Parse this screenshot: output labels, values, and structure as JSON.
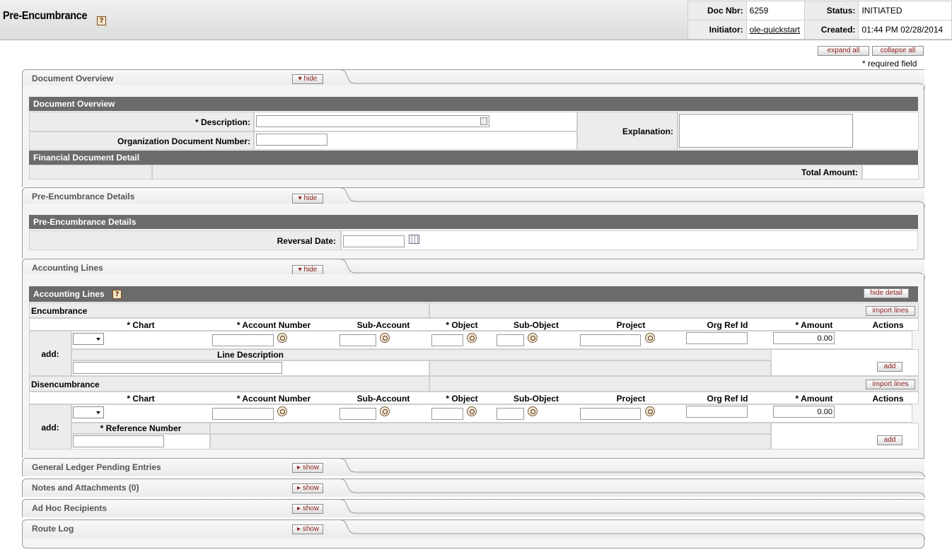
{
  "header": {
    "title": "Pre-Encumbrance",
    "help_icon": "question-icon",
    "doc_nbr_label": "Doc Nbr:",
    "doc_nbr": "6259",
    "status_label": "Status:",
    "status": "INITIATED",
    "initiator_label": "Initiator:",
    "initiator": "ole-quickstart",
    "created_label": "Created:",
    "created": "01:44 PM 02/28/2014"
  },
  "top_controls": {
    "expand_all": "expand all",
    "collapse_all": "collapse all",
    "required_note": "* required field"
  },
  "tabs": {
    "overview": {
      "title": "Document Overview",
      "toggle": "hide"
    },
    "details": {
      "title": "Pre-Encumbrance Details",
      "toggle": "hide"
    },
    "accounting": {
      "title": "Accounting Lines",
      "toggle": "hide"
    },
    "glpe": {
      "title": "General Ledger Pending Entries",
      "toggle": "show"
    },
    "notes": {
      "title": "Notes and Attachments (0)",
      "toggle": "show"
    },
    "adhoc": {
      "title": "Ad Hoc Recipients",
      "toggle": "show"
    },
    "route": {
      "title": "Route Log",
      "toggle": "show"
    }
  },
  "overview": {
    "section_title": "Document Overview",
    "description_label": "*  Description:",
    "org_doc_label": "Organization Document Number:",
    "explanation_label": "Explanation:",
    "fin_detail_title": "Financial Document Detail",
    "total_amount_label": "Total Amount:"
  },
  "details": {
    "section_title": "Pre-Encumbrance Details",
    "reversal_date_label": "Reversal Date:"
  },
  "accounting": {
    "section_title": "Accounting Lines",
    "hide_detail": "hide detail",
    "encumbrance_title": "Encumbrance",
    "disencumbrance_title": "Disencumbrance",
    "import_lines": "import lines",
    "columns": [
      "* Chart",
      "* Account Number",
      "Sub-Account",
      "* Object",
      "Sub-Object",
      "Project",
      "Org Ref Id",
      "* Amount",
      "Actions"
    ],
    "add_label": "add:",
    "line_description_label": "Line Description",
    "reference_number_label": "* Reference Number",
    "amount_value": "0.00",
    "add_button": "add"
  }
}
